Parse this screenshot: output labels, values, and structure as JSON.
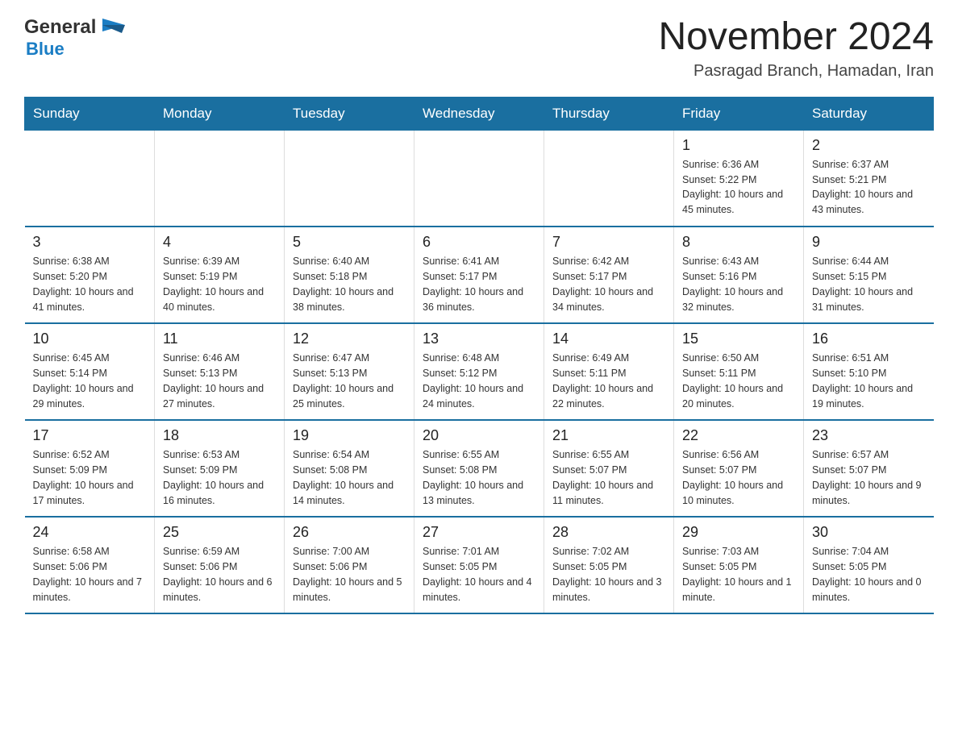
{
  "header": {
    "logo_general": "General",
    "logo_blue": "Blue",
    "title": "November 2024",
    "subtitle": "Pasragad Branch, Hamadan, Iran"
  },
  "days_of_week": [
    "Sunday",
    "Monday",
    "Tuesday",
    "Wednesday",
    "Thursday",
    "Friday",
    "Saturday"
  ],
  "weeks": [
    {
      "days": [
        {
          "num": "",
          "info": ""
        },
        {
          "num": "",
          "info": ""
        },
        {
          "num": "",
          "info": ""
        },
        {
          "num": "",
          "info": ""
        },
        {
          "num": "",
          "info": ""
        },
        {
          "num": "1",
          "info": "Sunrise: 6:36 AM\nSunset: 5:22 PM\nDaylight: 10 hours and 45 minutes."
        },
        {
          "num": "2",
          "info": "Sunrise: 6:37 AM\nSunset: 5:21 PM\nDaylight: 10 hours and 43 minutes."
        }
      ]
    },
    {
      "days": [
        {
          "num": "3",
          "info": "Sunrise: 6:38 AM\nSunset: 5:20 PM\nDaylight: 10 hours and 41 minutes."
        },
        {
          "num": "4",
          "info": "Sunrise: 6:39 AM\nSunset: 5:19 PM\nDaylight: 10 hours and 40 minutes."
        },
        {
          "num": "5",
          "info": "Sunrise: 6:40 AM\nSunset: 5:18 PM\nDaylight: 10 hours and 38 minutes."
        },
        {
          "num": "6",
          "info": "Sunrise: 6:41 AM\nSunset: 5:17 PM\nDaylight: 10 hours and 36 minutes."
        },
        {
          "num": "7",
          "info": "Sunrise: 6:42 AM\nSunset: 5:17 PM\nDaylight: 10 hours and 34 minutes."
        },
        {
          "num": "8",
          "info": "Sunrise: 6:43 AM\nSunset: 5:16 PM\nDaylight: 10 hours and 32 minutes."
        },
        {
          "num": "9",
          "info": "Sunrise: 6:44 AM\nSunset: 5:15 PM\nDaylight: 10 hours and 31 minutes."
        }
      ]
    },
    {
      "days": [
        {
          "num": "10",
          "info": "Sunrise: 6:45 AM\nSunset: 5:14 PM\nDaylight: 10 hours and 29 minutes."
        },
        {
          "num": "11",
          "info": "Sunrise: 6:46 AM\nSunset: 5:13 PM\nDaylight: 10 hours and 27 minutes."
        },
        {
          "num": "12",
          "info": "Sunrise: 6:47 AM\nSunset: 5:13 PM\nDaylight: 10 hours and 25 minutes."
        },
        {
          "num": "13",
          "info": "Sunrise: 6:48 AM\nSunset: 5:12 PM\nDaylight: 10 hours and 24 minutes."
        },
        {
          "num": "14",
          "info": "Sunrise: 6:49 AM\nSunset: 5:11 PM\nDaylight: 10 hours and 22 minutes."
        },
        {
          "num": "15",
          "info": "Sunrise: 6:50 AM\nSunset: 5:11 PM\nDaylight: 10 hours and 20 minutes."
        },
        {
          "num": "16",
          "info": "Sunrise: 6:51 AM\nSunset: 5:10 PM\nDaylight: 10 hours and 19 minutes."
        }
      ]
    },
    {
      "days": [
        {
          "num": "17",
          "info": "Sunrise: 6:52 AM\nSunset: 5:09 PM\nDaylight: 10 hours and 17 minutes."
        },
        {
          "num": "18",
          "info": "Sunrise: 6:53 AM\nSunset: 5:09 PM\nDaylight: 10 hours and 16 minutes."
        },
        {
          "num": "19",
          "info": "Sunrise: 6:54 AM\nSunset: 5:08 PM\nDaylight: 10 hours and 14 minutes."
        },
        {
          "num": "20",
          "info": "Sunrise: 6:55 AM\nSunset: 5:08 PM\nDaylight: 10 hours and 13 minutes."
        },
        {
          "num": "21",
          "info": "Sunrise: 6:55 AM\nSunset: 5:07 PM\nDaylight: 10 hours and 11 minutes."
        },
        {
          "num": "22",
          "info": "Sunrise: 6:56 AM\nSunset: 5:07 PM\nDaylight: 10 hours and 10 minutes."
        },
        {
          "num": "23",
          "info": "Sunrise: 6:57 AM\nSunset: 5:07 PM\nDaylight: 10 hours and 9 minutes."
        }
      ]
    },
    {
      "days": [
        {
          "num": "24",
          "info": "Sunrise: 6:58 AM\nSunset: 5:06 PM\nDaylight: 10 hours and 7 minutes."
        },
        {
          "num": "25",
          "info": "Sunrise: 6:59 AM\nSunset: 5:06 PM\nDaylight: 10 hours and 6 minutes."
        },
        {
          "num": "26",
          "info": "Sunrise: 7:00 AM\nSunset: 5:06 PM\nDaylight: 10 hours and 5 minutes."
        },
        {
          "num": "27",
          "info": "Sunrise: 7:01 AM\nSunset: 5:05 PM\nDaylight: 10 hours and 4 minutes."
        },
        {
          "num": "28",
          "info": "Sunrise: 7:02 AM\nSunset: 5:05 PM\nDaylight: 10 hours and 3 minutes."
        },
        {
          "num": "29",
          "info": "Sunrise: 7:03 AM\nSunset: 5:05 PM\nDaylight: 10 hours and 1 minute."
        },
        {
          "num": "30",
          "info": "Sunrise: 7:04 AM\nSunset: 5:05 PM\nDaylight: 10 hours and 0 minutes."
        }
      ]
    }
  ]
}
